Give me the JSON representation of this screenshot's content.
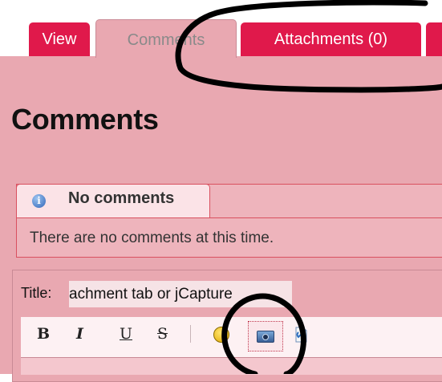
{
  "tabs": [
    {
      "label": "View",
      "active": false
    },
    {
      "label": "Comments",
      "active": true
    },
    {
      "label": "Attachments (0)",
      "active": false
    }
  ],
  "page_title": "Comments",
  "comments_box": {
    "header": "No comments",
    "message": "There are no comments at this time."
  },
  "form": {
    "title_label": "Title:",
    "title_value": "achment tab or jCapture"
  },
  "toolbar": {
    "bold_label": "B",
    "italic_label": "I",
    "underline_label": "U",
    "strike_label": "S",
    "icons": [
      "smiley-icon",
      "camera-icon",
      "attachment-icon"
    ]
  },
  "colors": {
    "tab_red": "#e0194b",
    "page_pink": "#e9a8b1",
    "annotation": "#000000"
  }
}
